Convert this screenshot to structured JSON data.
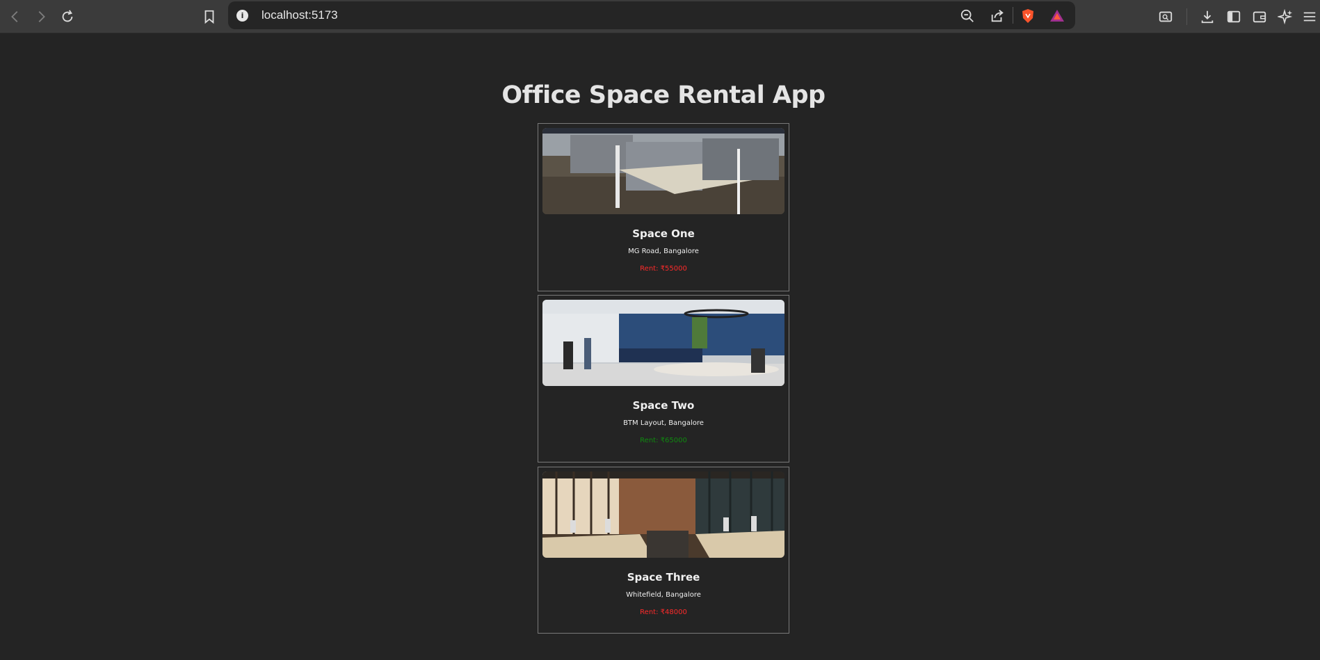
{
  "browser": {
    "url": "localhost:5173"
  },
  "page": {
    "title": "Office Space Rental App"
  },
  "spaces": [
    {
      "name": "Space One",
      "location": "MG Road, Bangalore",
      "rent": "Rent: ₹55000",
      "rent_color": "#ff2a2a"
    },
    {
      "name": "Space Two",
      "location": "BTM Layout, Bangalore",
      "rent": "Rent: ₹65000",
      "rent_color": "#0f8a0f"
    },
    {
      "name": "Space Three",
      "location": "Whitefield, Bangalore",
      "rent": "Rent: ₹48000",
      "rent_color": "#ff2a2a"
    }
  ]
}
